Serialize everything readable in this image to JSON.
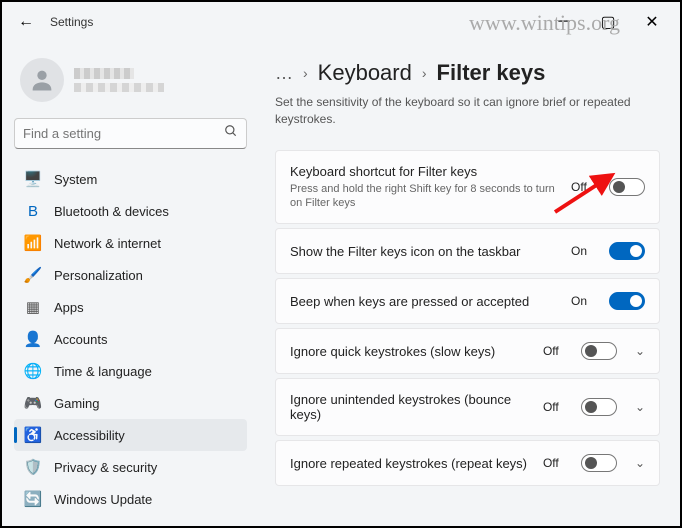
{
  "watermark": "www.wintips.org",
  "app_title": "Settings",
  "search": {
    "placeholder": "Find a setting"
  },
  "sidebar": {
    "items": [
      {
        "label": "System",
        "icon": "🖥️",
        "color": "#0067c0"
      },
      {
        "label": "Bluetooth & devices",
        "icon": "B",
        "color": "#0067c0"
      },
      {
        "label": "Network & internet",
        "icon": "📶",
        "color": "#0ea5c7"
      },
      {
        "label": "Personalization",
        "icon": "🖌️",
        "color": "#c68b3e"
      },
      {
        "label": "Apps",
        "icon": "▦",
        "color": "#555"
      },
      {
        "label": "Accounts",
        "icon": "👤",
        "color": "#d65a3a"
      },
      {
        "label": "Time & language",
        "icon": "🌐",
        "color": "#3aa0a0"
      },
      {
        "label": "Gaming",
        "icon": "🎮",
        "color": "#888"
      },
      {
        "label": "Accessibility",
        "icon": "♿",
        "color": "#0067c0",
        "active": true
      },
      {
        "label": "Privacy & security",
        "icon": "🛡️",
        "color": "#666"
      },
      {
        "label": "Windows Update",
        "icon": "🔄",
        "color": "#0091d0"
      }
    ]
  },
  "breadcrumb": {
    "dots": "…",
    "parent": "Keyboard",
    "current": "Filter keys"
  },
  "page": {
    "subtitle": "Set the sensitivity of the keyboard so it can ignore brief or repeated keystrokes."
  },
  "settings": [
    {
      "label": "Keyboard shortcut for Filter keys",
      "desc": "Press and hold the right Shift key for 8 seconds to turn on Filter keys",
      "state": "Off",
      "on": false,
      "expandable": false
    },
    {
      "label": "Show the Filter keys icon on the taskbar",
      "desc": "",
      "state": "On",
      "on": true,
      "expandable": false
    },
    {
      "label": "Beep when keys are pressed or accepted",
      "desc": "",
      "state": "On",
      "on": true,
      "expandable": false
    },
    {
      "label": "Ignore quick keystrokes (slow keys)",
      "desc": "",
      "state": "Off",
      "on": false,
      "expandable": true
    },
    {
      "label": "Ignore unintended keystrokes (bounce keys)",
      "desc": "",
      "state": "Off",
      "on": false,
      "expandable": true
    },
    {
      "label": "Ignore repeated keystrokes (repeat keys)",
      "desc": "",
      "state": "Off",
      "on": false,
      "expandable": true
    }
  ]
}
